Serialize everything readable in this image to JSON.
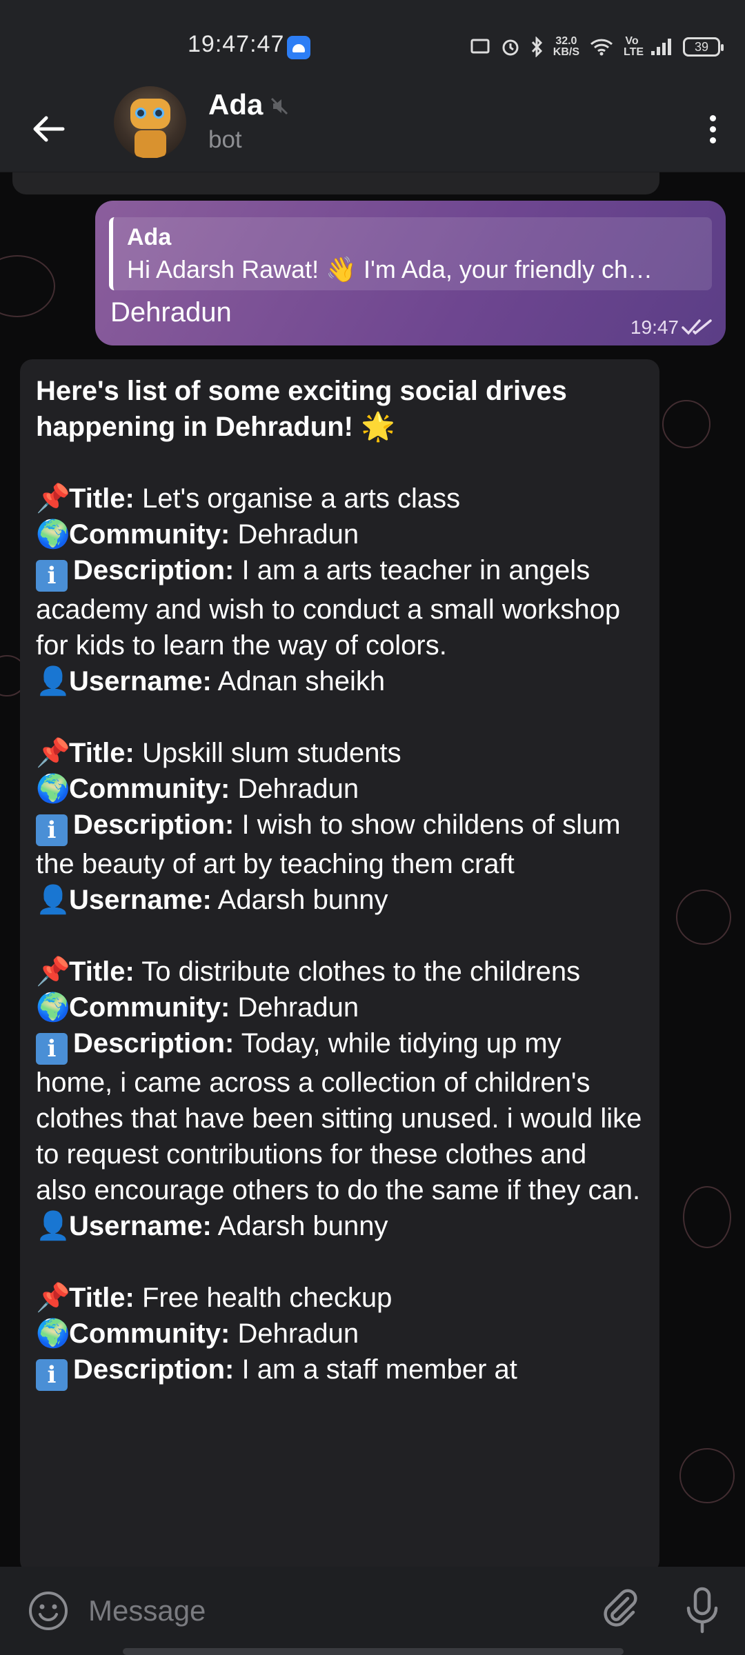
{
  "status_bar": {
    "time": "19:47:47",
    "speed_top": "32.0",
    "speed_bottom": "KB/S",
    "network": "Vo LTE",
    "battery": "39"
  },
  "header": {
    "title": "Ada",
    "subtitle": "bot"
  },
  "outgoing": {
    "reply_name": "Ada",
    "reply_text": "Hi Adarsh Rawat! 👋 I'm Ada, your friendly ch…",
    "text": "Dehradun",
    "time": "19:47"
  },
  "incoming": {
    "heading": "Here's list of some exciting social drives happening in Dehradun! 🌟",
    "labels": {
      "title": "Title:",
      "community": "Community:",
      "description": "Description:",
      "username": "Username:"
    },
    "drives": [
      {
        "title": "Let's organise a arts class",
        "community": "Dehradun",
        "description": "I am a arts teacher in angels academy and wish to conduct a small workshop for kids to learn the way of colors.",
        "username": "Adnan sheikh"
      },
      {
        "title": "Upskill slum students",
        "community": "Dehradun",
        "description": "I wish to show childens of slum the beauty of art by teaching them craft",
        "username": "Adarsh bunny"
      },
      {
        "title": "To distribute clothes to the childrens",
        "community": "Dehradun",
        "description": "Today, while tidying up my home, i came across a collection of children's clothes that have been sitting unused. i would like to request contributions for these clothes and also encourage others to do the same if they can.",
        "username": "Adarsh bunny"
      },
      {
        "title": "Free health checkup",
        "community": "Dehradun",
        "description": "I am a staff member at",
        "username": ""
      }
    ]
  },
  "input": {
    "placeholder": "Message"
  },
  "colors": {
    "header_bg": "#222326",
    "outgoing_bubble": "#7a4f94",
    "incoming_bubble": "#212124",
    "chat_bg": "#0b0b0c"
  }
}
